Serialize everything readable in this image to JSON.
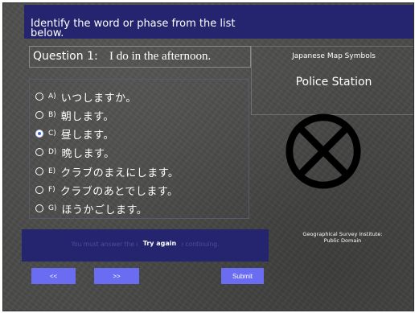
{
  "instruction": "Identify the word or phase from the list below.",
  "question": {
    "label": "Question 1:",
    "text": "I do in the afternoon."
  },
  "options": [
    {
      "letter": "A)",
      "text": "いつしますか。",
      "selected": false
    },
    {
      "letter": "B)",
      "text": "朝します。",
      "selected": false
    },
    {
      "letter": "C)",
      "text": "昼します。",
      "selected": true
    },
    {
      "letter": "D)",
      "text": "晩します。",
      "selected": false
    },
    {
      "letter": "E)",
      "text": "クラブのまえにします。",
      "selected": false
    },
    {
      "letter": "F)",
      "text": "クラブのあとでします。",
      "selected": false
    },
    {
      "letter": "G)",
      "text": "ほうかごします。",
      "selected": false
    }
  ],
  "map_panel": {
    "title": "Japanese Map Symbols",
    "symbol_name": "Police Station",
    "symbol_icon": "police-station-x-circle-icon",
    "credit_line1": "Geographical Survey Institute:",
    "credit_line2": "Public Domain"
  },
  "feedback": {
    "message": "You must answer the question before continuing.",
    "try_again": "Try again"
  },
  "nav": {
    "prev_label": "<<",
    "next_label": ">>",
    "submit_label": "Submit"
  },
  "colors": {
    "bar": "#25246e",
    "button": "#6a6cf2",
    "background": "#4a4a49",
    "radio_selected": "#3a66d6"
  }
}
